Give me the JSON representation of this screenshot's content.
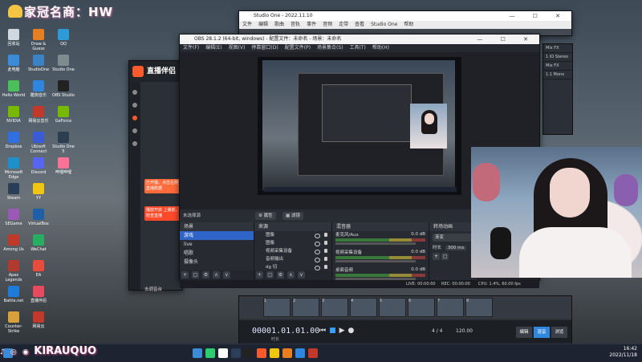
{
  "desktop": {
    "watermark": "家冠名商：HW",
    "bottom_banner": "KIRAUQUO",
    "icons": [
      {
        "label": "回收站",
        "color": "#cfd8e0"
      },
      {
        "label": "此电脑",
        "color": "#3a8bd8"
      },
      {
        "label": "Hello World",
        "color": "#4bbf5a"
      },
      {
        "label": "NVIDIA",
        "color": "#76b900"
      },
      {
        "label": "Dropbox",
        "color": "#2f6fe0"
      },
      {
        "label": "Microsoft Edge",
        "color": "#1e90c9"
      },
      {
        "label": "Steam",
        "color": "#2a3e57"
      },
      {
        "label": "SEGame",
        "color": "#9b59b6"
      },
      {
        "label": "Among Us",
        "color": "#c0392b"
      },
      {
        "label": "Apex Legends",
        "color": "#b03a2e"
      },
      {
        "label": "Battle.net",
        "color": "#1f7bd8"
      },
      {
        "label": "Counter-Strike",
        "color": "#d8a03a"
      },
      {
        "label": "Draw & Guess",
        "color": "#e67e22"
      },
      {
        "label": "StudioOne",
        "color": "#3b82c4"
      },
      {
        "label": "酷狗音乐",
        "color": "#2e86de"
      },
      {
        "label": "网易云音乐",
        "color": "#c0392b"
      },
      {
        "label": "Ubisoft Connect",
        "color": "#3a5bd8"
      },
      {
        "label": "Discord",
        "color": "#5865f2"
      },
      {
        "label": "YY",
        "color": "#f1c40f"
      },
      {
        "label": "VirtualBox",
        "color": "#1f5fa8"
      },
      {
        "label": "WeChat",
        "color": "#27ae60"
      },
      {
        "label": "EA",
        "color": "#e74c3c"
      },
      {
        "label": "直播伴侣",
        "color": "#e84a5f"
      },
      {
        "label": "网易云",
        "color": "#c0392b"
      },
      {
        "label": "QQ",
        "color": "#2e9bd8"
      },
      {
        "label": "Studio One",
        "color": "#7f8c8d"
      },
      {
        "label": "OBS Studio",
        "color": "#222222"
      },
      {
        "label": "GeForce",
        "color": "#76b900"
      },
      {
        "label": "Studio One 5",
        "color": "#2c3e50"
      },
      {
        "label": "哔哩哔哩",
        "color": "#fb7299"
      }
    ]
  },
  "studio_one": {
    "title": "Studio One - 2022.11.10",
    "menu": [
      "文件",
      "编辑",
      "歌曲",
      "音轨",
      "事件",
      "音频",
      "走带",
      "查看",
      "Studio One",
      "帮助"
    ],
    "timecode": "00001.01.01.00",
    "time_label": "时长",
    "meter": "4 / 4",
    "tempo": "120.00",
    "mode_buttons": [
      "编辑",
      "混音",
      "浏览"
    ],
    "tracks": [
      "1",
      "2",
      "3",
      "4",
      "5",
      "6",
      "7",
      "8"
    ],
    "right_panel": [
      "Mix FX",
      "1 IO Stereo",
      "Mix FX",
      "1.1 Mono"
    ]
  },
  "live_app": {
    "title": "直播伴侣",
    "toast1": "已开播，点击左侧查看直播数据",
    "toast2": "播放开启 上播前，请检查直播",
    "footer": "去调音台"
  },
  "obs": {
    "title": "OBS 28.1.2 (64-bit, windows) - 配置文件：未命名 - 场景：未命名",
    "menu": [
      "文件(F)",
      "编辑(E)",
      "视图(V)",
      "停靠窗口(D)",
      "配置文件(P)",
      "场景集合(S)",
      "工具(T)",
      "帮助(H)"
    ],
    "no_source": "未选择源",
    "btn_properties": "属性",
    "btn_filters": "滤镜",
    "scenes_header": "场景",
    "scenes": [
      "游戏",
      "live",
      "唱歌",
      "摄像头"
    ],
    "sources_header": "来源",
    "sources": [
      "图像",
      "图像",
      "视频采集设备",
      "音频输出",
      "dg 切",
      "显示器采集",
      "图像"
    ],
    "mixer_header": "混音器",
    "mixer": [
      {
        "name": "麦克风/Aux",
        "db": "0.0 dB"
      },
      {
        "name": "视频采集设备",
        "db": "0.0 dB"
      },
      {
        "name": "桌面音频",
        "db": "0.0 dB"
      }
    ],
    "transitions_header": "转场动画",
    "transition": "渐变",
    "duration_label": "时长",
    "duration": "300 ms",
    "status_live": "LIVE: 00:00:00",
    "status_rec": "REC: 00:00:00",
    "status_cpu": "CPU: 1.4%, 60.00 fps"
  },
  "taskbar": {
    "time": "16:42",
    "date": "2022/11/18",
    "apps": [
      "#3a8bd8",
      "#2ecc71",
      "#ffffff",
      "#2a3e57",
      "#222222",
      "#ff5a2b",
      "#f1c40f",
      "#e67e22",
      "#2e86de",
      "#c0392b"
    ]
  }
}
